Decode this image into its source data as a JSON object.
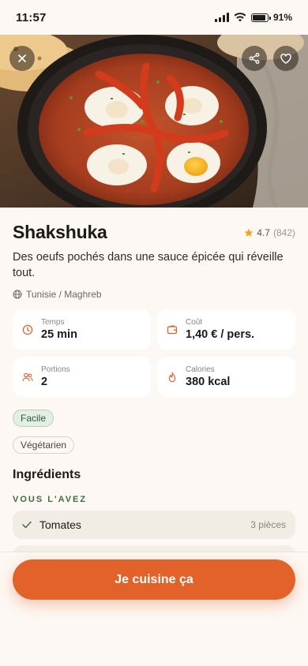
{
  "status_bar": {
    "time": "11:57",
    "battery": "91%",
    "battery_level": 0.91
  },
  "hero": {
    "image_alt": "Shakshuka",
    "icons": [
      "close-icon",
      "share-icon",
      "heart-icon"
    ]
  },
  "recipe": {
    "title": "Shakshuka",
    "rating": "4.7",
    "rating_count": "(842)",
    "description": "Des oeufs pochés dans une sauce épicée qui réveille tout.",
    "origin": "Tunisie / Maghreb"
  },
  "stats": [
    {
      "label": "Temps",
      "value": "25 min",
      "icon": "clock-icon"
    },
    {
      "label": "Coût",
      "value": "1,40 € / pers.",
      "icon": "wallet-icon"
    },
    {
      "label": "Portions",
      "value": "2",
      "icon": "users-icon"
    },
    {
      "label": "Calories",
      "value": "380 kcal",
      "icon": "flame-icon"
    }
  ],
  "tags": [
    "Facile",
    "Végétarien"
  ],
  "ingredients": {
    "title": "Ingrédients",
    "have_label": "VOUS L'AVEZ",
    "items": [
      {
        "name": "Tomates",
        "qty": "3 pièces"
      }
    ]
  },
  "cta": {
    "label": "Je cuisine ça"
  },
  "colors": {
    "accent": "#e2622a",
    "green": "#3e6b44",
    "background": "#fdf8f3"
  }
}
